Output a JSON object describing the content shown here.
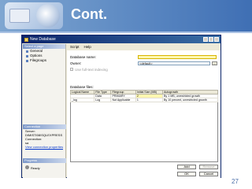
{
  "slide": {
    "title": "Cont.",
    "page_number": "27"
  },
  "dialog": {
    "title": "New Database",
    "left_panel": {
      "select_page_header": "Select a page",
      "pages": [
        "General",
        "Options",
        "Filegroups"
      ],
      "connection_header": "Connection",
      "server_label": "Server:",
      "server_value": "DIMISTI08\\SQLEXPRESS",
      "connection_label": "Connection:",
      "connection_value": "sa",
      "view_connection_link": "View connection properties",
      "progress_header": "Progress",
      "progress_status": "Ready"
    },
    "toolbar": {
      "script": "Script",
      "help": "Help"
    },
    "form": {
      "database_name_label": "Database name:",
      "database_name_value": "",
      "owner_label": "Owner:",
      "owner_value": "<default>",
      "dots_label": "...",
      "fulltext_label": "Use full-text indexing",
      "database_files_label": "Database files:"
    },
    "grid": {
      "headers": [
        "Logical Name",
        "File Type",
        "Filegroup",
        "Initial Size (MB)",
        "Autogrowth"
      ],
      "rows": [
        [
          "",
          "Data",
          "PRIMARY",
          "2",
          "By 1 MB, unrestricted growth"
        ],
        [
          "_log",
          "Log",
          "Not Applicable",
          "1",
          "By 10 percent, unrestricted growth"
        ]
      ]
    },
    "buttons": {
      "add": "Add",
      "remove": "Remove",
      "ok": "OK",
      "cancel": "Cancel"
    }
  }
}
